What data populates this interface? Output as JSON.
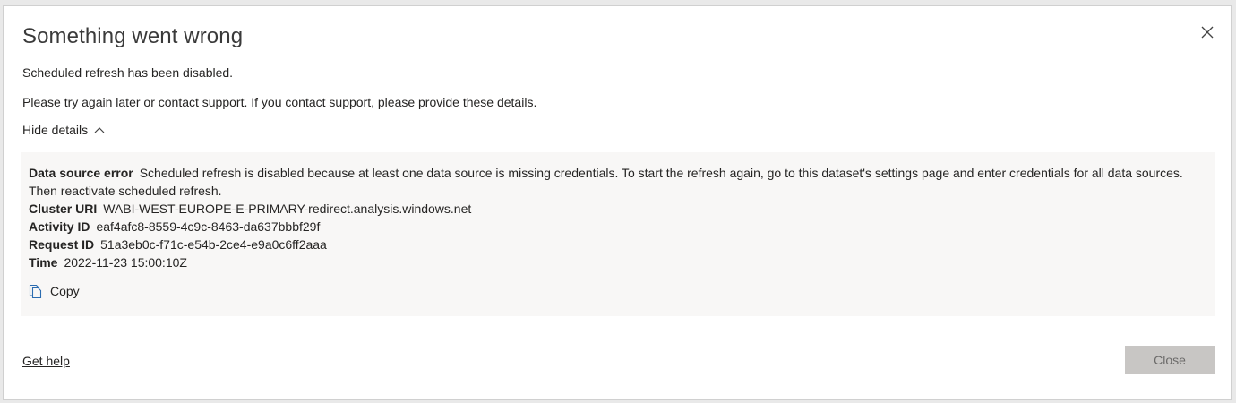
{
  "dialog": {
    "title": "Something went wrong",
    "message": "Scheduled refresh has been disabled.",
    "support_message": "Please try again later or contact support. If you contact support, please provide these details.",
    "toggle_label": "Hide details"
  },
  "details": {
    "error_label": "Data source error",
    "error_text": "Scheduled refresh is disabled because at least one data source is missing credentials. To start the refresh again, go to this dataset's settings page and enter credentials for all data sources. Then reactivate scheduled refresh.",
    "cluster_label": "Cluster URI",
    "cluster_value": "WABI-WEST-EUROPE-E-PRIMARY-redirect.analysis.windows.net",
    "activity_label": "Activity ID",
    "activity_value": "eaf4afc8-8559-4c9c-8463-da637bbbf29f",
    "request_label": "Request ID",
    "request_value": "51a3eb0c-f71c-e54b-2ce4-e9a0c6ff2aaa",
    "time_label": "Time",
    "time_value": "2022-11-23 15:00:10Z",
    "copy_label": "Copy"
  },
  "footer": {
    "help_label": "Get help",
    "close_label": "Close"
  },
  "icons": {
    "close": "close-icon",
    "chevron": "chevron-up-icon",
    "copy": "copy-icon"
  },
  "colors": {
    "details_bg": "#f8f7f6",
    "close_button_bg": "#c8c6c4",
    "text": "#252423"
  }
}
